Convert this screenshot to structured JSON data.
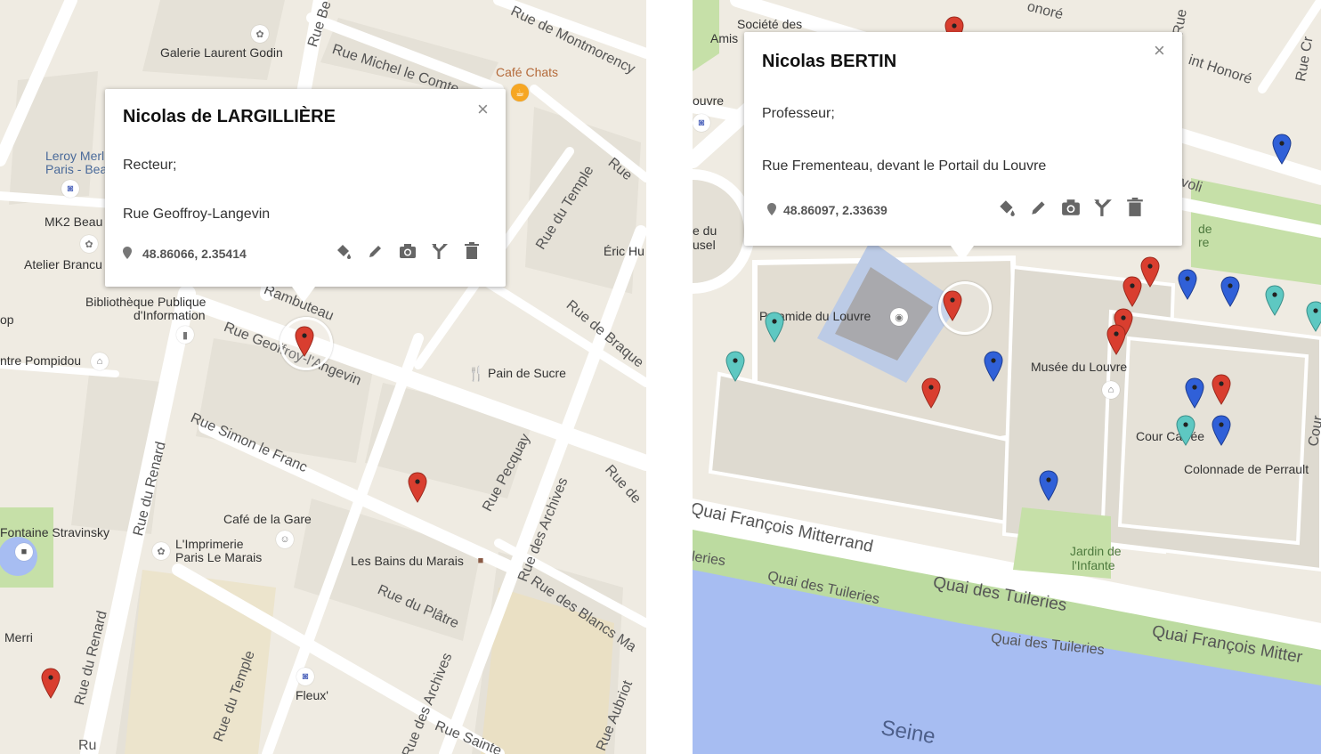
{
  "left_map": {
    "popup": {
      "name": "Nicolas de LARGILLIÈRE",
      "role": "Recteur;",
      "address": "Rue Geoffroy-Langevin",
      "coords": "48.86066, 2.35414",
      "close": "×"
    },
    "labels": {
      "galerie": "Galerie Laurent Godin",
      "rue_michel": "Rue Michel le Comte",
      "rue_montmorency": "Rue de Montmorency",
      "cafe_chats": "Café Chats",
      "leroy1": "Leroy Merl",
      "leroy2": "Paris - Bea",
      "mk2": "MK2 Beau",
      "atelier": "Atelier Brancu",
      "biblio1": "Bibliothèque Publique",
      "biblio2": "d'Information",
      "pompidou": "ntre Pompidou",
      "op": "op",
      "rambuteau": "Rambuteau",
      "geoffroy": "Rue Geoffroy-l'Angevin",
      "rue_temple_top": "Rue du Temple",
      "eric": "Éric Hu",
      "braque": "Rue de Braque",
      "pain_sucre": "Pain de Sucre",
      "simon": "Rue Simon le Franc",
      "renard": "Rue du Renard",
      "renard2": "Rue du Renard",
      "pecquay": "Rue Pecquay",
      "archives": "Rue des Archives",
      "archives2": "Rue des Archives",
      "cafe_gare": "Café de la Gare",
      "stravinsky": "Fontaine Stravinsky",
      "imprimerie1": "L'Imprimerie",
      "imprimerie2": "Paris Le Marais",
      "bains": "Les Bains du Marais",
      "platre": "Rue du Plâtre",
      "blancs": "Rue des Blancs Ma",
      "merri": "Merri",
      "temple_bottom": "Rue du Temple",
      "fleux": "Fleux'",
      "aubriot": "Rue Aubriot",
      "sainte": "Rue Sainte",
      "rue_be": "Rue Be",
      "rue_right": "Rue",
      "rue_de_right": "Rue de",
      "rue_bl": "Ru"
    },
    "pins": [
      "red",
      "red",
      "red"
    ]
  },
  "right_map": {
    "popup": {
      "name": "Nicolas BERTIN",
      "role": "Professeur;",
      "address": "Rue Frementeau, devant le Portail du Louvre",
      "coords": "48.86097, 2.33639",
      "close": "×"
    },
    "labels": {
      "societe1": "Société des",
      "societe2": "Amis",
      "louvre_left": "ouvre",
      "du": "e du",
      "usel": "usel",
      "honore": "int Honoré",
      "honore_top": "onoré",
      "rivoli": "ivoli",
      "de_re1": "de",
      "de_re2": "re",
      "pyramide": "Pyramide du Louvre",
      "musee": "Musée du Louvre",
      "cour_carree": "Cour Carrée",
      "colonnade": "Colonnade de Perrault",
      "quai_fm_left": "Quai François Mitterrand",
      "quai_fm_right": "Quai François Mitter",
      "quai_tuileries": "Quai des Tuileries",
      "quai_tuileries2": "Quai des Tuileries",
      "quai_tuileries3": "Quai des Tuileries",
      "eries": "leries",
      "jardin1": "Jardin de",
      "jardin2": "l'Infante",
      "seine": "Seine",
      "rue_top": "Rue",
      "rue_cr": "Rue Cr",
      "cour_right": "Cour"
    },
    "pin_colors": {
      "red": "#d93e2f",
      "blue": "#3060d8",
      "teal": "#5ec8c2"
    }
  },
  "colors": {
    "map_bg": "#efebe2",
    "road": "#ffffff",
    "building": "#e4e0d6",
    "water": "#a7bdf2",
    "park": "#c6e0a8",
    "pin_red": "#d93e2f"
  },
  "icons": [
    "map-pin-icon",
    "paint-bucket-icon",
    "pencil-icon",
    "camera-icon",
    "directions-icon",
    "trash-icon",
    "close-icon"
  ]
}
